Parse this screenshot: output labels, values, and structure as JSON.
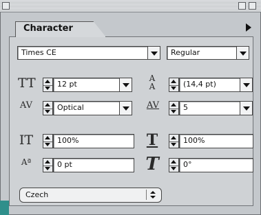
{
  "panel": {
    "tab_label": "Character"
  },
  "font": {
    "family": "Times CE",
    "style": "Regular"
  },
  "size": {
    "value": "12 pt"
  },
  "leading": {
    "value": "(14,4 pt)"
  },
  "kerning": {
    "value": "Optical"
  },
  "tracking": {
    "value": "5"
  },
  "vertical_scale": {
    "value": "100%"
  },
  "horizontal_scale": {
    "value": "100%"
  },
  "baseline_shift": {
    "value": "0 pt"
  },
  "skew": {
    "value": "0°"
  },
  "language": {
    "value": "Czech"
  },
  "icons": {
    "size": "font-size-icon",
    "leading": "leading-icon",
    "kerning": "kerning-icon",
    "tracking": "tracking-icon",
    "vertical_scale": "vertical-scale-icon",
    "horizontal_scale": "horizontal-scale-icon",
    "baseline_shift": "baseline-shift-icon",
    "skew": "skew-icon"
  },
  "colors": {
    "panel_bg": "#cfd2d5",
    "field_bg": "#ffffff",
    "accent": "#2f8f8b"
  }
}
